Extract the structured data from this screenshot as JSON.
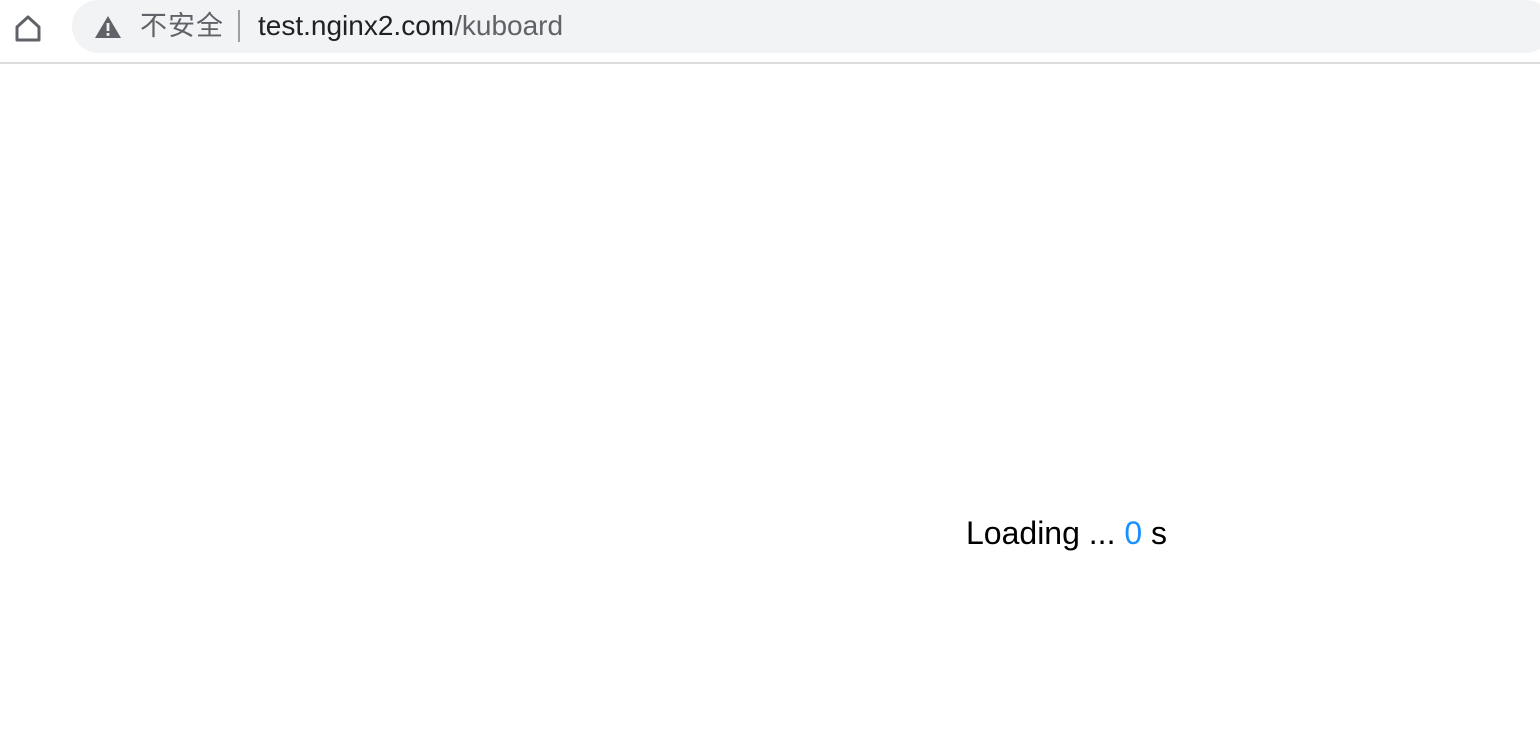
{
  "browser": {
    "security_label": "不安全",
    "url": {
      "host": "test.nginx2.com",
      "path": "/kuboard"
    }
  },
  "page": {
    "loading_text": "Loading ... ",
    "seconds": "0",
    "unit": " s"
  },
  "icons": {
    "home": "home-icon",
    "warning": "warning-icon"
  },
  "colors": {
    "counter": "#1890ff",
    "omnibox_bg": "#f1f3f4",
    "url_host": "#202124",
    "url_path": "#5f6368"
  }
}
